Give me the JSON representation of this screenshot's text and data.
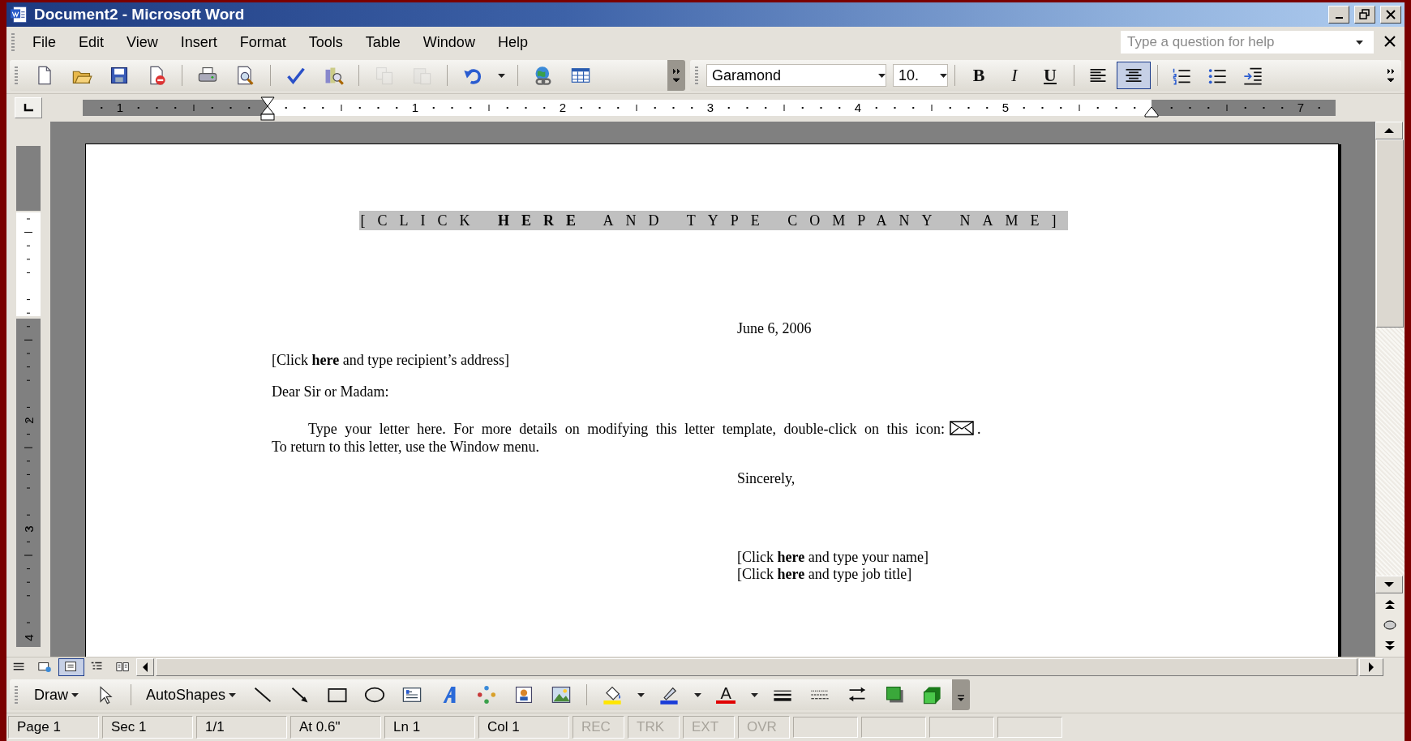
{
  "window": {
    "title": "Document2 - Microsoft Word"
  },
  "menu": [
    {
      "label": "File"
    },
    {
      "label": "Edit"
    },
    {
      "label": "View"
    },
    {
      "label": "Insert"
    },
    {
      "label": "Format"
    },
    {
      "label": "Tools"
    },
    {
      "label": "Table"
    },
    {
      "label": "Window"
    },
    {
      "label": "Help"
    }
  ],
  "help_box": {
    "placeholder": "Type a question for help"
  },
  "standard_toolbar": [
    {
      "kind": "new",
      "disabled": false
    },
    {
      "kind": "open",
      "disabled": false
    },
    {
      "kind": "save",
      "disabled": false
    },
    {
      "kind": "permission",
      "disabled": false
    },
    {
      "kind": "sep"
    },
    {
      "kind": "print",
      "disabled": false
    },
    {
      "kind": "preview",
      "disabled": false
    },
    {
      "kind": "sep"
    },
    {
      "kind": "spelling",
      "disabled": false
    },
    {
      "kind": "research",
      "disabled": false
    },
    {
      "kind": "sep"
    },
    {
      "kind": "copy",
      "disabled": true
    },
    {
      "kind": "paste",
      "disabled": true
    },
    {
      "kind": "sep"
    },
    {
      "kind": "undo",
      "disabled": false
    },
    {
      "kind": "caret",
      "disabled": false
    },
    {
      "kind": "sep"
    },
    {
      "kind": "hyperlink",
      "disabled": false
    },
    {
      "kind": "table",
      "disabled": false
    }
  ],
  "formatting_toolbar": {
    "font": "Garamond",
    "size": "10.",
    "buttons": [
      {
        "kind": "bold",
        "label": "B",
        "selected": false
      },
      {
        "kind": "italic",
        "label": "I",
        "selected": false
      },
      {
        "kind": "underline",
        "label": "U",
        "selected": false
      },
      {
        "kind": "sep"
      },
      {
        "kind": "align-left",
        "selected": false
      },
      {
        "kind": "align-center",
        "selected": true
      },
      {
        "kind": "sep"
      },
      {
        "kind": "numbering",
        "selected": false
      },
      {
        "kind": "bullets",
        "selected": false
      },
      {
        "kind": "outdent",
        "selected": false
      }
    ]
  },
  "ruler": {
    "labels": [
      "1",
      "1",
      "2",
      "3",
      "4",
      "5",
      "7"
    ]
  },
  "vertical_ruler": {
    "labels": [
      "2",
      "3",
      "4"
    ]
  },
  "document": {
    "company_name": "[CLICK **HERE** AND TYPE COMPANY NAME]",
    "date": "June 6, 2006",
    "recipient": "[Click **here** and type recipient’s address]",
    "salutation": "Dear Sir or Madam:",
    "body_line_1": "Type your letter here. For more details on modifying this letter template, double-click on this icon:",
    "body_line_1_end": ".",
    "body_line_2": "To return to this letter, use the Window menu.",
    "closing": "Sincerely,",
    "name": "[Click **here** and type your name]",
    "job_title": "[Click **here** and type job title]"
  },
  "view_buttons": [
    {
      "kind": "normal",
      "selected": false
    },
    {
      "kind": "web",
      "selected": false
    },
    {
      "kind": "print",
      "selected": true
    },
    {
      "kind": "outline",
      "selected": false
    },
    {
      "kind": "reading",
      "selected": false
    }
  ],
  "drawing_toolbar": [
    {
      "kind": "menu",
      "label": "Draw"
    },
    {
      "kind": "select"
    },
    {
      "kind": "sep"
    },
    {
      "kind": "menu",
      "label": "AutoShapes"
    },
    {
      "kind": "line"
    },
    {
      "kind": "arrow"
    },
    {
      "kind": "rectangle"
    },
    {
      "kind": "oval"
    },
    {
      "kind": "textbox"
    },
    {
      "kind": "wordart"
    },
    {
      "kind": "diagram"
    },
    {
      "kind": "clipart"
    },
    {
      "kind": "picture"
    },
    {
      "kind": "sep"
    },
    {
      "kind": "fill"
    },
    {
      "kind": "caret"
    },
    {
      "kind": "line-color"
    },
    {
      "kind": "caret"
    },
    {
      "kind": "font-color",
      "label": "A"
    },
    {
      "kind": "caret"
    },
    {
      "kind": "line-style"
    },
    {
      "kind": "dash-style"
    },
    {
      "kind": "arrow-style"
    },
    {
      "kind": "shadow"
    },
    {
      "kind": "cube"
    }
  ],
  "status_bar": [
    {
      "label": "Page 1",
      "disabled": false
    },
    {
      "label": "Sec 1",
      "disabled": false
    },
    {
      "label": "1/1",
      "disabled": false
    },
    {
      "label": "At 0.6\"",
      "disabled": false
    },
    {
      "label": "Ln 1",
      "disabled": false
    },
    {
      "label": "Col 1",
      "disabled": false
    },
    {
      "label": "REC",
      "disabled": true
    },
    {
      "label": "TRK",
      "disabled": true
    },
    {
      "label": "EXT",
      "disabled": true
    },
    {
      "label": "OVR",
      "disabled": true
    }
  ]
}
